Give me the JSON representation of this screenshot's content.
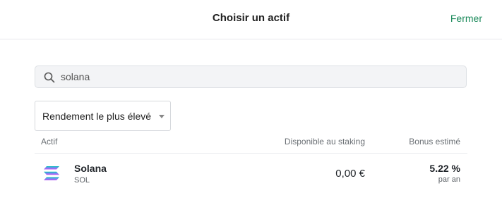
{
  "header": {
    "title": "Choisir un actif",
    "close_label": "Fermer"
  },
  "search": {
    "value": "solana",
    "icon": "search-icon"
  },
  "sort": {
    "selected": "Rendement le plus élevé"
  },
  "table": {
    "columns": [
      "Actif",
      "Disponible au staking",
      "Bonus estimé"
    ],
    "rows": [
      {
        "icon": "solana-logo-icon",
        "name": "Solana",
        "symbol": "SOL",
        "available": "0,00 €",
        "bonus": "5.22 %",
        "bonus_period": "par an"
      }
    ]
  },
  "colors": {
    "accent": "#1c8a5b",
    "solana_gradient": [
      "#00ffa3",
      "#dc1fff"
    ]
  }
}
